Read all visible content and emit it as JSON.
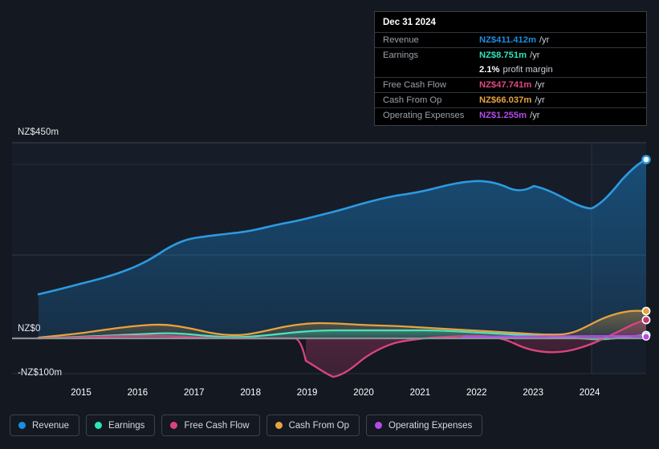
{
  "tooltip": {
    "date": "Dec 31 2024",
    "rows": [
      {
        "key": "Revenue",
        "value": "NZ$411.412m",
        "unit": "/yr",
        "color": "#1a8fe0"
      },
      {
        "key": "Earnings",
        "value": "NZ$8.751m",
        "unit": "/yr",
        "color": "#2ee6b8"
      },
      {
        "key": "",
        "value": "2.1%",
        "unit": "profit margin",
        "color": "#ffffff"
      },
      {
        "key": "Free Cash Flow",
        "value": "NZ$47.741m",
        "unit": "/yr",
        "color": "#e0487f"
      },
      {
        "key": "Cash From Op",
        "value": "NZ$66.037m",
        "unit": "/yr",
        "color": "#e8a33d"
      },
      {
        "key": "Operating Expenses",
        "value": "NZ$1.255m",
        "unit": "/yr",
        "color": "#b44ae8"
      }
    ]
  },
  "axes": {
    "y_top": "NZ$450m",
    "y_zero": "NZ$0",
    "y_bottom": "-NZ$100m"
  },
  "legend": [
    {
      "label": "Revenue",
      "color": "#1a8fe0"
    },
    {
      "label": "Earnings",
      "color": "#2ee6b8"
    },
    {
      "label": "Free Cash Flow",
      "color": "#d9447c"
    },
    {
      "label": "Cash From Op",
      "color": "#e8a33d"
    },
    {
      "label": "Operating Expenses",
      "color": "#b44ae8"
    }
  ],
  "chart_data": {
    "type": "area",
    "title": "",
    "xlabel": "",
    "ylabel": "",
    "ylim": [
      -100,
      450
    ],
    "currency": "NZD millions",
    "grid": true,
    "legend_position": "bottom",
    "gridlines": [
      "NZ$450m",
      "NZ$0",
      "-NZ$100m"
    ],
    "x_tick_labels": [
      "2015",
      "2016",
      "2017",
      "2018",
      "2019",
      "2020",
      "2021",
      "2022",
      "2023",
      "2024"
    ],
    "x": [
      2014.3,
      2015.0,
      2015.5,
      2016.0,
      2016.5,
      2017.0,
      2017.5,
      2018.0,
      2018.5,
      2019.0,
      2019.5,
      2020.0,
      2020.5,
      2021.0,
      2021.5,
      2022.0,
      2022.5,
      2023.0,
      2023.5,
      2024.0,
      2024.5,
      2025.0
    ],
    "series": [
      {
        "name": "Revenue",
        "color": "#1a8fe0",
        "values": [
          152,
          170,
          182,
          196,
          215,
          244,
          258,
          261,
          266,
          288,
          296,
          300,
          309,
          327,
          350,
          352,
          354,
          372,
          357,
          340,
          371,
          411
        ]
      },
      {
        "name": "Earnings",
        "color": "#2ee6b8",
        "values": [
          2,
          3,
          5,
          7,
          9,
          11,
          10,
          8,
          6,
          7,
          9,
          12,
          14,
          16,
          17,
          16,
          14,
          11,
          8,
          4,
          6,
          8.751
        ]
      },
      {
        "name": "Free Cash Flow",
        "color": "#d9447c",
        "values": [
          1,
          2,
          4,
          6,
          8,
          7,
          5,
          4,
          -18,
          -48,
          -62,
          -40,
          -12,
          2,
          6,
          5,
          -6,
          -18,
          -22,
          -14,
          18,
          47.741
        ]
      },
      {
        "name": "Cash From Op",
        "color": "#e8a33d",
        "values": [
          4,
          8,
          12,
          16,
          20,
          23,
          19,
          14,
          13,
          16,
          21,
          26,
          29,
          32,
          34,
          33,
          31,
          28,
          24,
          18,
          40,
          66.037
        ]
      },
      {
        "name": "Operating Expenses",
        "color": "#b44ae8",
        "values": [
          null,
          null,
          null,
          null,
          null,
          null,
          null,
          null,
          null,
          null,
          null,
          null,
          1.0,
          1.0,
          1.05,
          1.1,
          1.1,
          1.15,
          1.2,
          1.2,
          1.22,
          1.255
        ]
      }
    ],
    "endpoint_markers": [
      {
        "series": "Revenue",
        "value": 411.412
      },
      {
        "series": "Cash From Op",
        "value": 66.037
      },
      {
        "series": "Free Cash Flow",
        "value": 47.741
      },
      {
        "series": "Earnings",
        "value": 8.751
      },
      {
        "series": "Operating Expenses",
        "value": 1.255
      }
    ]
  }
}
